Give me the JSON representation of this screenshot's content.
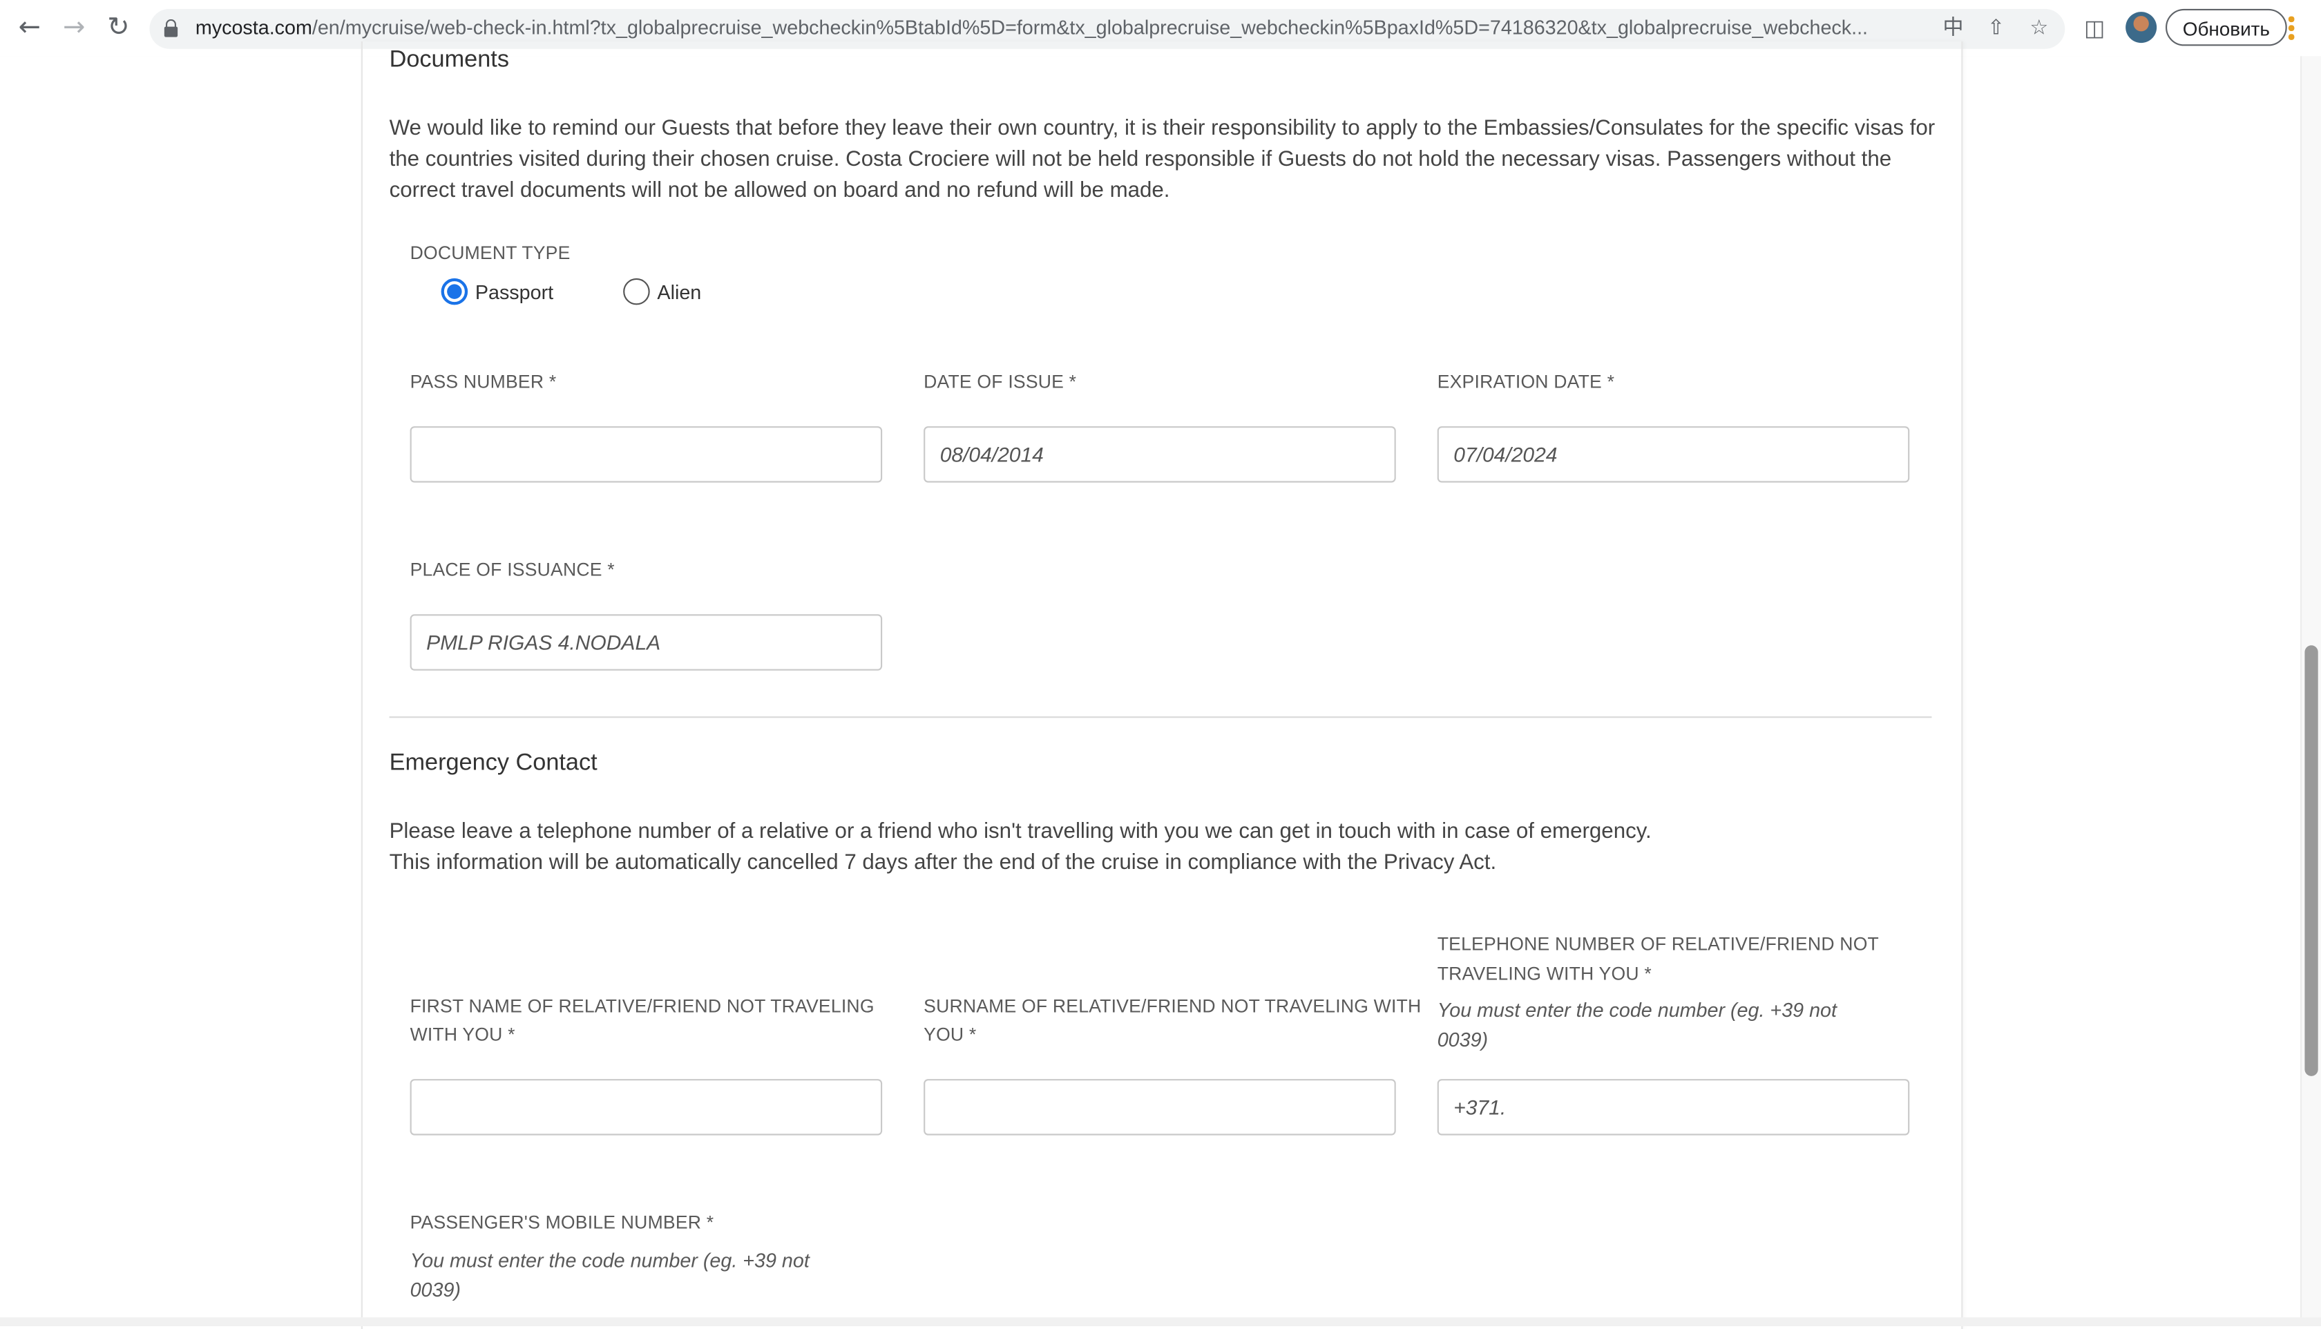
{
  "browser": {
    "url_host": "mycosta.com",
    "url_rest": "/en/mycruise/web-check-in.html?tx_globalprecruise_webcheckin%5BtabId%5D=form&tx_globalprecruise_webcheckin%5BpaxId%5D=74186320&tx_globalprecruise_webcheck...",
    "update_label": "Обновить",
    "icons": {
      "back": "back-arrow-icon",
      "forward": "forward-arrow-icon",
      "reload": "reload-icon",
      "lock": "lock-icon",
      "translate": "translate-icon",
      "share": "share-icon",
      "bookmark": "star-icon",
      "sidepanel": "side-panel-icon",
      "menu": "kebab-menu-icon"
    }
  },
  "documents": {
    "title": "Documents",
    "reminder": "We would like to remind our Guests that before they leave their own country, it is their responsibility to apply to the Embassies/Consulates for the specific visas for the countries visited during their chosen cruise. Costa Crociere will not be held responsible if Guests do not hold the necessary visas.  Passengers without the correct travel documents will not be allowed on board and no refund will be made.",
    "document_type_label": "DOCUMENT TYPE",
    "options": [
      {
        "label": "Passport",
        "selected": true
      },
      {
        "label": "Alien",
        "selected": false
      }
    ],
    "pass_number": {
      "label": "PASS NUMBER *",
      "value": ""
    },
    "date_of_issue": {
      "label": "DATE OF ISSUE *",
      "value": "08/04/2014"
    },
    "expiration_date": {
      "label": "EXPIRATION DATE *",
      "value": "07/04/2024"
    },
    "place_of_issuance": {
      "label": "PLACE OF ISSUANCE *",
      "value": "PMLP RIGAS 4.NODALA"
    }
  },
  "emergency": {
    "title": "Emergency Contact",
    "line1": "Please leave a telephone number of a relative or a friend who isn't travelling with you we can get in touch with in case of emergency.",
    "line2": "This information will be automatically cancelled 7 days after the end of the cruise in compliance with the Privacy Act.",
    "first_name": {
      "label_1": "FIRST NAME OF RELATIVE/FRIEND NOT TRAVELING",
      "label_2": "WITH YOU *",
      "value": ""
    },
    "surname": {
      "label_1": "SURNAME OF RELATIVE/FRIEND NOT TRAVELING WITH",
      "label_2": "YOU *",
      "value": ""
    },
    "telephone": {
      "label_1": "TELEPHONE NUMBER OF RELATIVE/FRIEND NOT",
      "label_2": "TRAVELING WITH YOU *",
      "hint_1": "You must enter the code number (eg. +39 not",
      "hint_2": "0039)",
      "value": "+371."
    },
    "mobile": {
      "label": "PASSENGER'S MOBILE NUMBER *",
      "hint_1": "You must enter the code number (eg. +39 not",
      "hint_2": "0039)"
    }
  },
  "colors": {
    "accent": "#1a73e8",
    "text": "#333333",
    "border": "#c9c9c9"
  }
}
